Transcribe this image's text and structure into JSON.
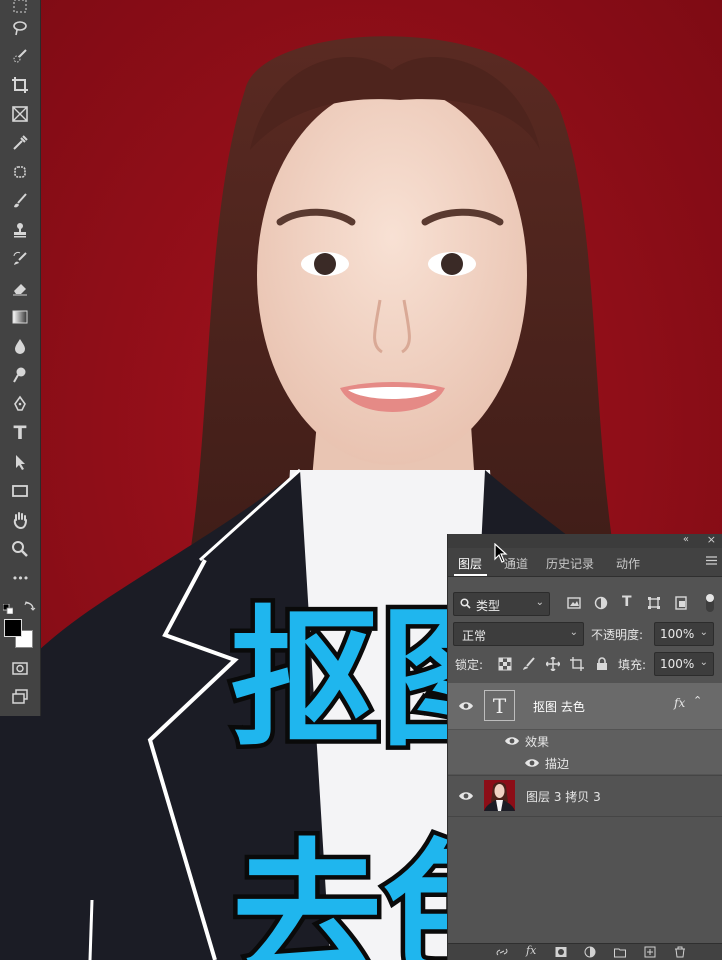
{
  "canvas": {
    "background_color": "#8c0d17",
    "overlay_text": {
      "line1": "抠图",
      "line2": "去色",
      "color": "#1fb6ee",
      "stroke": "#0a0a0a"
    }
  },
  "toolbar": {
    "tools": [
      "move-icon",
      "lasso-icon",
      "quick-select-icon",
      "crop-icon",
      "frame-icon",
      "eyedropper-icon",
      "healing-icon",
      "brush-icon",
      "stamp-icon",
      "history-brush-icon",
      "eraser-icon",
      "gradient-icon",
      "blur-icon",
      "dodge-icon",
      "pen-icon",
      "type-icon",
      "path-select-icon",
      "rectangle-icon",
      "hand-icon",
      "zoom-icon",
      "more-icon"
    ],
    "type_tool_glyph": "T",
    "more_glyph": "•••"
  },
  "layers_panel": {
    "collapse_glyph": "«",
    "close_glyph": "×",
    "tabs": [
      {
        "label": "图层",
        "active": true
      },
      {
        "label": "通道",
        "active": false
      },
      {
        "label": "历史记录",
        "active": false
      },
      {
        "label": "动作",
        "active": false
      }
    ],
    "filter": {
      "value": "类型"
    },
    "blend_mode": "正常",
    "opacity_label": "不透明度:",
    "opacity_value": "100%",
    "lock_label": "锁定:",
    "fill_label": "填充:",
    "fill_value": "100%",
    "layers": [
      {
        "name": "抠图 去色",
        "type": "text",
        "thumb_glyph": "T",
        "fx": "fx",
        "effects_label": "效果",
        "effects": [
          "描边"
        ]
      },
      {
        "name": "图层 3 拷贝 3",
        "type": "image"
      }
    ],
    "bottom_fx": "fx"
  }
}
